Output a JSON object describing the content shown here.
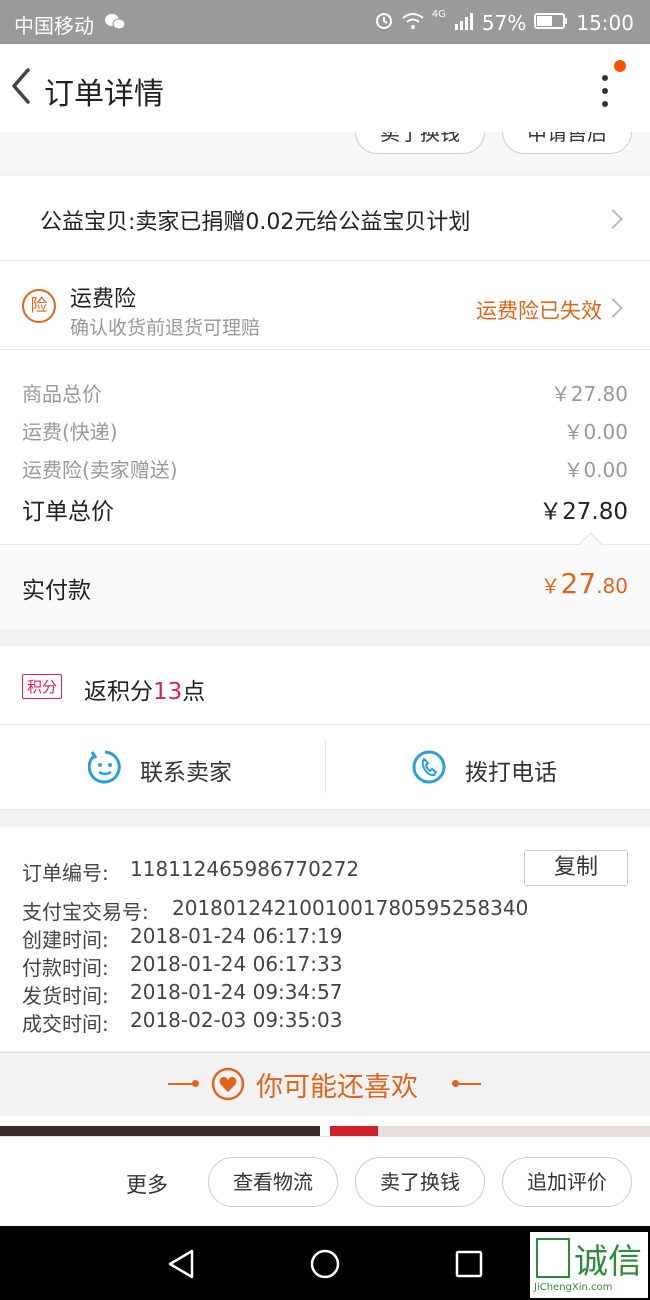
{
  "status_bar": {
    "carrier": "中国移动",
    "network": "4G",
    "battery": "57%",
    "time": "15:00"
  },
  "header": {
    "title": "订单详情"
  },
  "top_buttons": [
    "卖了换钱",
    "申请售后"
  ],
  "charity": {
    "text": "公益宝贝:卖家已捐赠0.02元给公益宝贝计划"
  },
  "insurance": {
    "icon_text": "险",
    "title": "运费险",
    "subtitle": "确认收货前退货可理赔",
    "status": "运费险已失效"
  },
  "prices": {
    "items": [
      {
        "label": "商品总价",
        "value": "￥27.80"
      },
      {
        "label": "运费(快递)",
        "value": "￥0.00"
      },
      {
        "label": "运费险(卖家赠送)",
        "value": "￥0.00"
      }
    ],
    "total_label": "订单总价",
    "total_value": "￥27.80",
    "paid_label": "实付款",
    "paid_currency": "￥",
    "paid_int": "27",
    "paid_dec": ".80"
  },
  "points": {
    "badge": "积分",
    "prefix": "返积分",
    "count": "13",
    "suffix": "点"
  },
  "contact": {
    "seller": "联系卖家",
    "phone": "拨打电话"
  },
  "order_info": {
    "copy_label": "复制",
    "fields": [
      {
        "label": "订单编号:",
        "value": "118112465986770272"
      },
      {
        "label": "支付宝交易号:",
        "value": "2018012421001001780595258340"
      },
      {
        "label": "创建时间:",
        "value": "2018-01-24 06:17:19"
      },
      {
        "label": "付款时间:",
        "value": "2018-01-24 06:17:33"
      },
      {
        "label": "发货时间:",
        "value": "2018-01-24 09:34:57"
      },
      {
        "label": "成交时间:",
        "value": "2018-02-03 09:35:03"
      }
    ]
  },
  "recommend": {
    "title": "你可能还喜欢"
  },
  "bottom_bar": {
    "more": "更多",
    "buttons": [
      "查看物流",
      "卖了换钱",
      "追加评价"
    ]
  },
  "watermark": {
    "text": "诚信",
    "sub": "JiChengXin.com"
  },
  "colors": {
    "accent": "#e0651c",
    "points": "#d3245b",
    "icon_blue": "#2a9fd8"
  }
}
